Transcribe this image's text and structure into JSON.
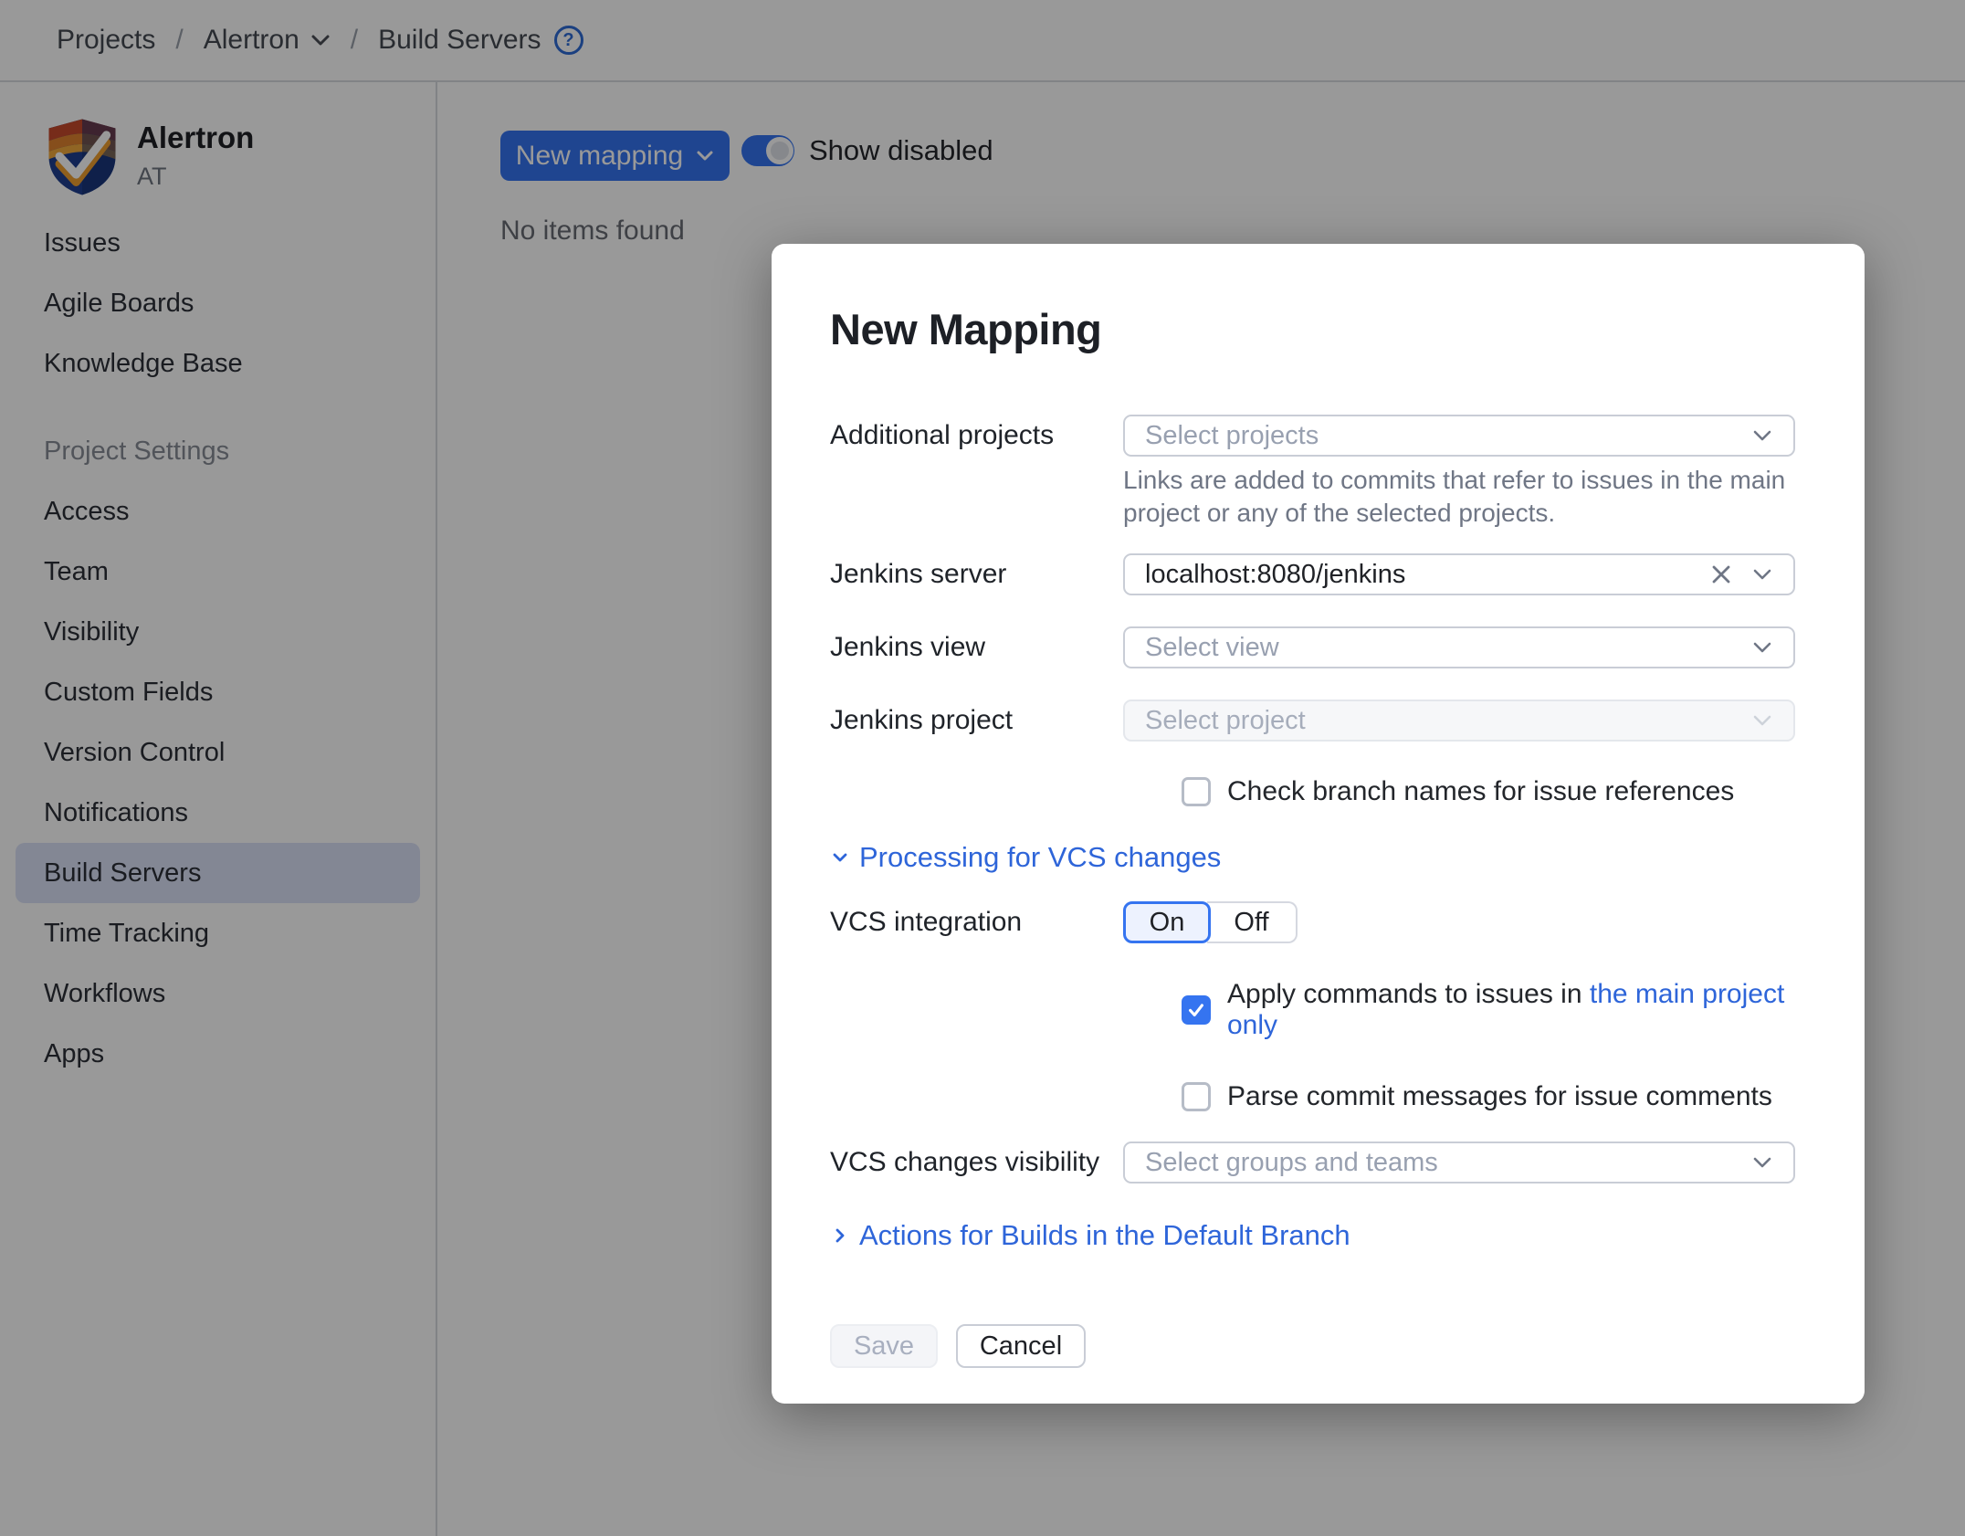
{
  "breadcrumb": {
    "items": [
      "Projects",
      "Alertron",
      "Build Servers"
    ]
  },
  "icons": {
    "breadcrumb_separator": "/",
    "help_glyph": "?"
  },
  "sidebar": {
    "project_name": "Alertron",
    "project_key": "AT",
    "nav_items": [
      "Issues",
      "Agile Boards",
      "Knowledge Base"
    ],
    "section_header": "Project Settings",
    "settings_items": [
      "Access",
      "Team",
      "Visibility",
      "Custom Fields",
      "Version Control",
      "Notifications",
      "Build Servers",
      "Time Tracking",
      "Workflows",
      "Apps"
    ],
    "selected_item": "Build Servers"
  },
  "content": {
    "new_mapping_button": "New mapping",
    "show_disabled_label": "Show disabled",
    "show_disabled_on": true,
    "empty_text": "No items found"
  },
  "modal": {
    "title": "New Mapping",
    "fields": {
      "additional_projects": {
        "label": "Additional projects",
        "placeholder": "Select projects",
        "help": "Links are added to commits that refer to issues in the main project or any of the selected projects."
      },
      "jenkins_server": {
        "label": "Jenkins server",
        "value": "localhost:8080/jenkins"
      },
      "jenkins_view": {
        "label": "Jenkins view",
        "placeholder": "Select view"
      },
      "jenkins_project": {
        "label": "Jenkins project",
        "placeholder": "Select project",
        "disabled": true
      },
      "vcs_visibility": {
        "label": "VCS changes visibility",
        "placeholder": "Select groups and teams"
      }
    },
    "sections": {
      "processing": "Processing for VCS changes",
      "actions": "Actions for Builds in the Default Branch"
    },
    "vcs_integration": {
      "label": "VCS integration",
      "on": "On",
      "off": "Off",
      "selected": "On"
    },
    "checkboxes": {
      "check_branch": {
        "label": "Check branch names for issue references",
        "checked": false
      },
      "apply_commands": {
        "label": "Apply commands to issues in",
        "link": "the main project only",
        "checked": true
      },
      "parse_commit": {
        "label": "Parse commit messages for issue comments",
        "checked": false
      }
    },
    "buttons": {
      "save": "Save",
      "cancel": "Cancel"
    }
  },
  "colors": {
    "accent": "#3574f0",
    "link": "#2e65d9",
    "selected_nav_bg": "#dbe2f7",
    "border": "#c9cdd6",
    "overlay": "rgba(0,0,0,0.4)",
    "disabled_bg": "#f6f7f9"
  }
}
